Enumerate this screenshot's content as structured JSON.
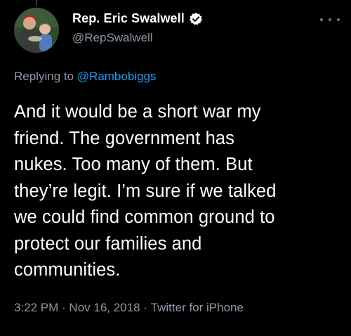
{
  "author": {
    "display_name": "Rep. Eric Swalwell",
    "handle": "@RepSwalwell",
    "verified": true,
    "avatar_icon": "profile-photo"
  },
  "reply": {
    "prefix": "Replying to ",
    "mention": "@Rambobiggs"
  },
  "tweet": {
    "lines": [
      "And it would be a short war my",
      "friend. The government has",
      "nukes. Too many of them. But",
      "they’re legit. I’m sure if we talked",
      "we could find common ground to",
      "protect our families and",
      "communities."
    ]
  },
  "meta": {
    "time": "3:22 PM",
    "separator": " · ",
    "date": "Nov 16, 2018",
    "source": "Twitter for iPhone"
  },
  "colors": {
    "background": "#000000",
    "text": "#ffffff",
    "muted": "#8b98a5",
    "accent": "#1d9bf0"
  }
}
